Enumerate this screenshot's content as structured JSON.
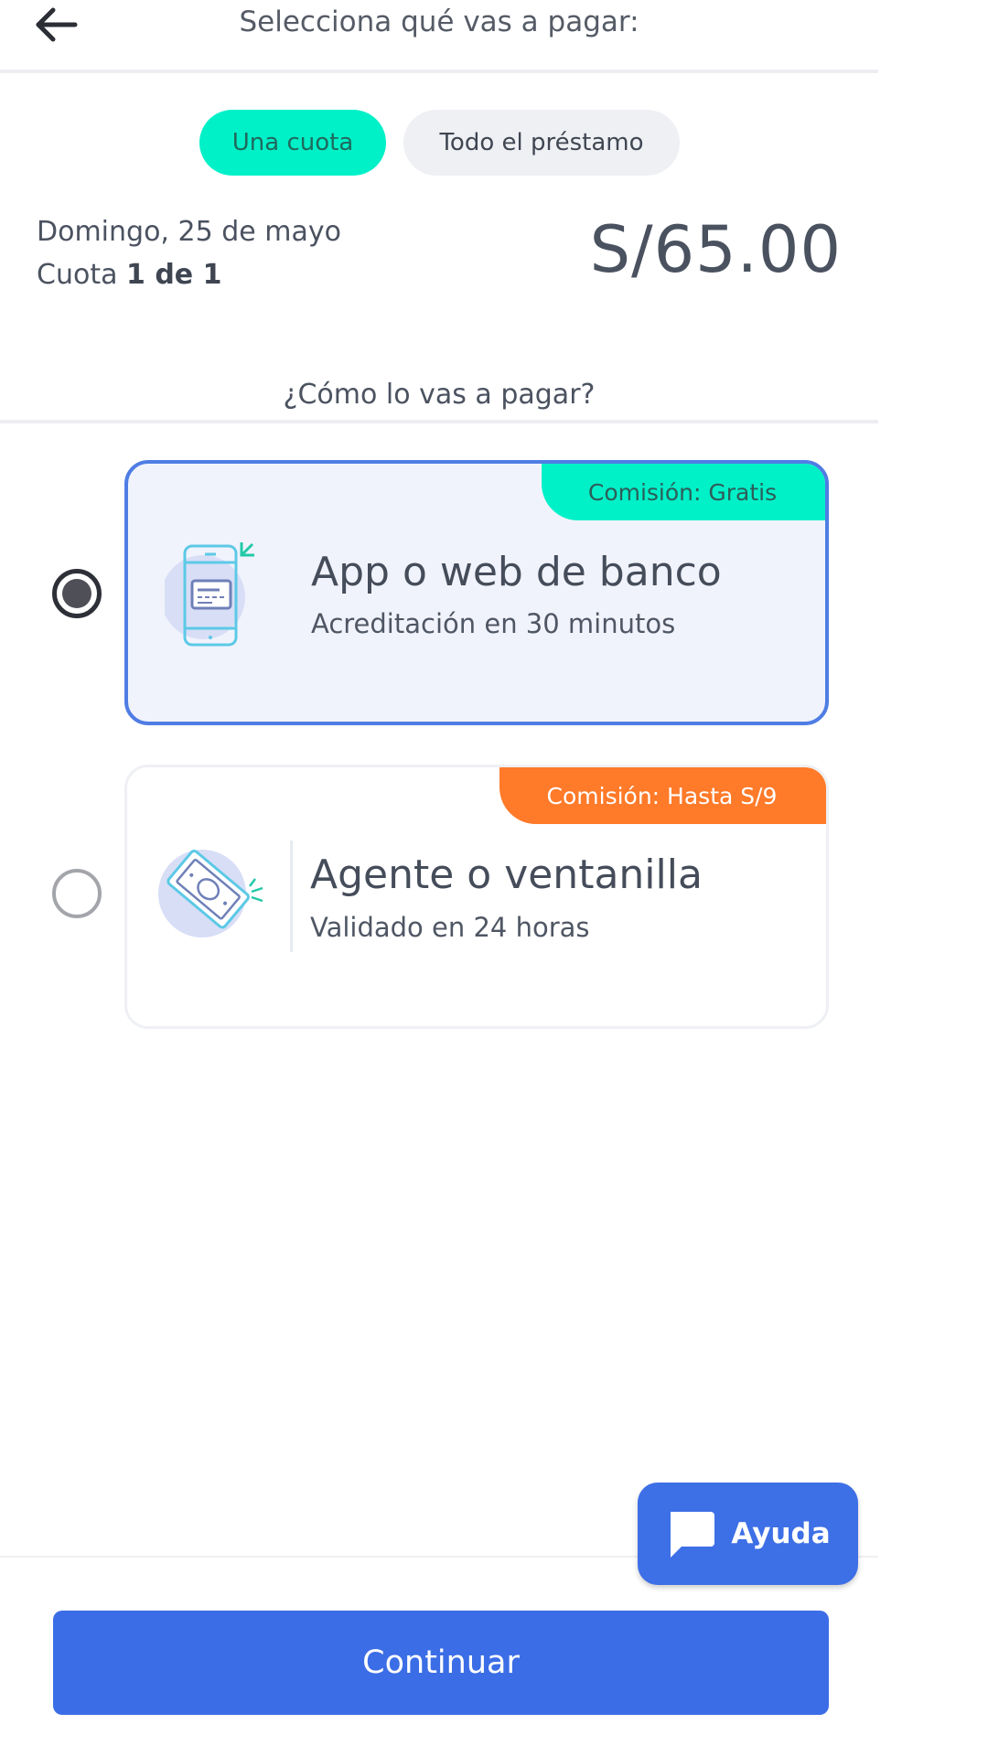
{
  "header": {
    "title": "Selecciona qué vas a pagar:",
    "back_icon": "arrow-left-icon"
  },
  "tabs": [
    {
      "label": "Una cuota",
      "active": true
    },
    {
      "label": "Todo el préstamo",
      "active": false
    }
  ],
  "installment": {
    "date": "Domingo, 25 de mayo",
    "cuota_prefix": "Cuota ",
    "cuota_value": "1 de 1",
    "amount": "S/65.00"
  },
  "payment": {
    "question": "¿Cómo lo vas a pagar?",
    "options": [
      {
        "title": "App o web de banco",
        "subtitle": "Acreditación en 30 minutos",
        "badge": "Comisión: Gratis",
        "icon": "mobile-banking-icon",
        "selected": true
      },
      {
        "title": "Agente o ventanilla",
        "subtitle": "Validado en 24 horas",
        "badge": "Comisión: Hasta S/9",
        "icon": "cash-bill-icon",
        "selected": false
      }
    ]
  },
  "help": {
    "label": "Ayuda",
    "icon": "chat-bubble-icon"
  },
  "continue": {
    "label": "Continuar"
  },
  "colors": {
    "accent_teal": "#00f0c8",
    "primary_blue": "#3b6de6",
    "fee_orange": "#ff7a29"
  }
}
